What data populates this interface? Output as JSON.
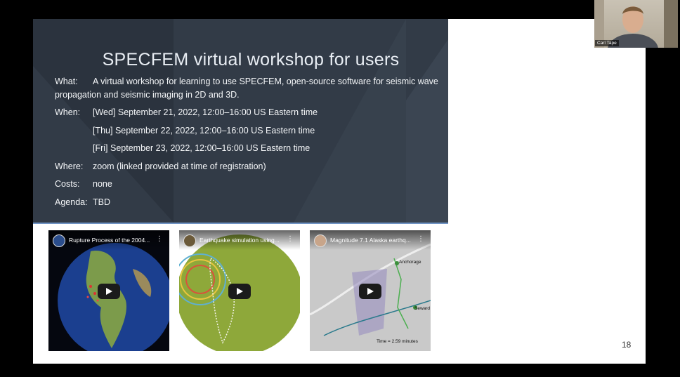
{
  "slide": {
    "title": "SPECFEM virtual workshop for users",
    "page_number": "18",
    "rows": [
      {
        "label": "What:",
        "value": "A virtual workshop for learning to use SPECFEM, open-source software for seismic wave"
      },
      {
        "label": "",
        "value": "propagation and seismic imaging in 2D and 3D."
      },
      {
        "label": "When:",
        "value": "[Wed] September 21, 2022, 12:00–16:00 US Eastern time"
      },
      {
        "label": "",
        "value": "[Thu] September 22, 2022, 12:00–16:00 US Eastern time"
      },
      {
        "label": "",
        "value": "[Fri] September 23, 2022, 12:00–16:00 US Eastern time"
      },
      {
        "label": "Where:",
        "value": "zoom (linked provided at time of registration)"
      },
      {
        "label": "Costs:",
        "value": "none"
      },
      {
        "label": "Agenda:",
        "value": "TBD"
      }
    ],
    "videos": [
      {
        "title": "Rupture Process of the 2004...",
        "icon": "play-icon"
      },
      {
        "title": "Earthquake simulation using...",
        "icon": "play-icon"
      },
      {
        "title": "Magnitude 7.1 Alaska earthq...",
        "icon": "play-icon"
      }
    ],
    "map_labels": {
      "anchorage": "Anchorage",
      "seward": "Seward",
      "time": "Time = 2.59 minutes"
    }
  },
  "webcam": {
    "name": "Carl Tape"
  },
  "colors": {
    "panel": "#323b47",
    "accent_line": "#6f93c4"
  }
}
